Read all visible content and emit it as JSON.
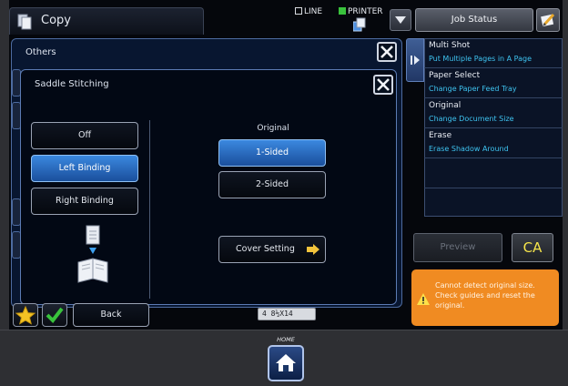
{
  "header": {
    "app_title": "Copy",
    "line_label": "LINE",
    "line_checked": false,
    "printer_label": "PRINTER",
    "printer_checked": true,
    "job_status_label": "Job Status"
  },
  "others": {
    "title": "Others"
  },
  "saddle_stitching": {
    "title": "Saddle Stitching",
    "binding_options": [
      {
        "label": "Off",
        "selected": false
      },
      {
        "label": "Left Binding",
        "selected": true
      },
      {
        "label": "Right Binding",
        "selected": false
      }
    ],
    "original_label": "Original",
    "original_options": [
      {
        "label": "1-Sided",
        "selected": true
      },
      {
        "label": "2-Sided",
        "selected": false
      }
    ],
    "cover_setting_label": "Cover Setting"
  },
  "side_panel": {
    "items": [
      {
        "title": "Multi Shot",
        "subtitle": "Put Multiple Pages in A Page"
      },
      {
        "title": "Paper Select",
        "subtitle": "Change Paper Feed Tray"
      },
      {
        "title": "Original",
        "subtitle": "Change Document Size"
      },
      {
        "title": "Erase",
        "subtitle": "Erase Shadow Around"
      }
    ]
  },
  "actions": {
    "preview_label": "Preview",
    "ca_label": "CA",
    "back_label": "Back"
  },
  "alert": {
    "message": "Cannot detect original size. Check guides and reset the original."
  },
  "paper_indicator": "4 8½X14",
  "home_label": "HOME",
  "colors": {
    "accent_blue": "#2f7fd8",
    "alert_orange": "#f08b22",
    "sub_text_cyan": "#3ec3f0",
    "ca_yellow": "#f5e44a"
  }
}
